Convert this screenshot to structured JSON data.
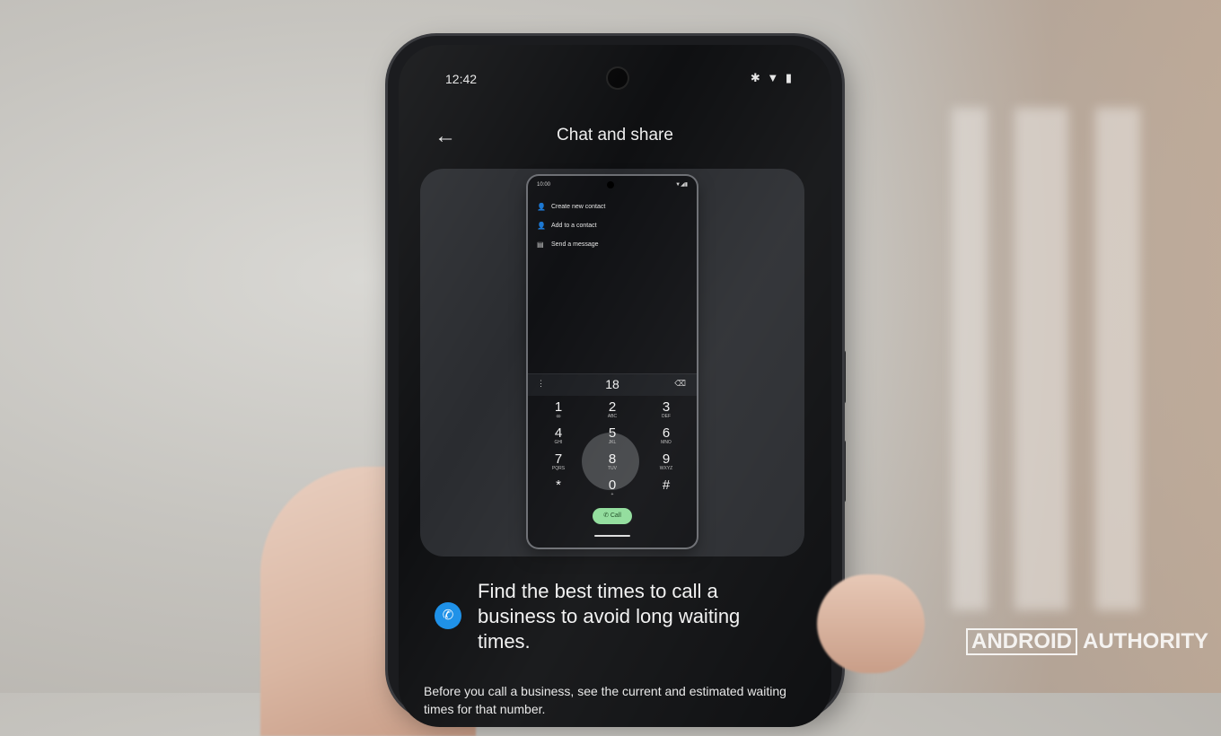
{
  "status_bar": {
    "time": "12:42",
    "icons": "✱ ▼ ▮"
  },
  "header": {
    "back_icon": "←",
    "title": "Chat and share"
  },
  "preview": {
    "status_time": "10:00",
    "status_icons": "▼◢▮",
    "menu": [
      {
        "icon": "add-contact-icon",
        "glyph": "👤",
        "label": "Create new contact"
      },
      {
        "icon": "add-to-contact-icon",
        "glyph": "👤",
        "label": "Add to a contact"
      },
      {
        "icon": "message-icon",
        "glyph": "▤",
        "label": "Send a message"
      }
    ],
    "dialed_number": "18",
    "more_icon": "⋮",
    "delete_icon": "⌫",
    "keys": [
      [
        {
          "d": "1",
          "l": "ꝏ"
        },
        {
          "d": "2",
          "l": "ABC"
        },
        {
          "d": "3",
          "l": "DEF"
        }
      ],
      [
        {
          "d": "4",
          "l": "GHI"
        },
        {
          "d": "5",
          "l": "JKL"
        },
        {
          "d": "6",
          "l": "MNO"
        }
      ],
      [
        {
          "d": "7",
          "l": "PQRS"
        },
        {
          "d": "8",
          "l": "TUV"
        },
        {
          "d": "9",
          "l": "WXYZ"
        }
      ],
      [
        {
          "d": "*",
          "l": ""
        },
        {
          "d": "0",
          "l": "+"
        },
        {
          "d": "#",
          "l": ""
        }
      ]
    ],
    "call_label": "Call"
  },
  "feature": {
    "icon": "phone-icon",
    "glyph": "✆",
    "text": "Find the best times to call a business to avoid long waiting times."
  },
  "body": {
    "text": "Before you call a business, see the current and estimated waiting times for that number."
  },
  "watermark": {
    "boxed": "ANDROID",
    "plain": "AUTHORITY"
  }
}
